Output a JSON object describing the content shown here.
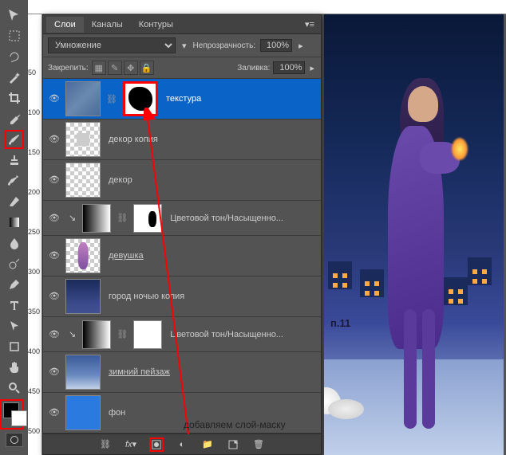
{
  "tabs": {
    "layers": "Слои",
    "channels": "Каналы",
    "paths": "Контуры"
  },
  "controls": {
    "blend_mode": "Умножение",
    "opacity_label": "Непрозрачность:",
    "opacity_value": "100%",
    "lock_label": "Закрепить:",
    "fill_label": "Заливка:",
    "fill_value": "100%"
  },
  "layers": [
    {
      "name": "текстура",
      "selected": true,
      "has_mask": true
    },
    {
      "name": "декор копия"
    },
    {
      "name": "декор"
    },
    {
      "name": "Цветовой тон/Насыщенно...",
      "adjustment": true,
      "clipped": true,
      "has_mask": true
    },
    {
      "name": "девушка",
      "underline": true
    },
    {
      "name": "город ночью копия"
    },
    {
      "name": "Цветовой тон/Насыщенно...",
      "adjustment": true,
      "clipped": true,
      "has_mask": true
    },
    {
      "name": "зимний пейзаж",
      "underline": true
    },
    {
      "name": "фон"
    }
  ],
  "annotation": "добавляем слой-маску",
  "canvas_label": "п.11",
  "ruler_marks": [
    "50",
    "100",
    "150",
    "200",
    "250",
    "300",
    "350",
    "400",
    "450",
    "500"
  ]
}
